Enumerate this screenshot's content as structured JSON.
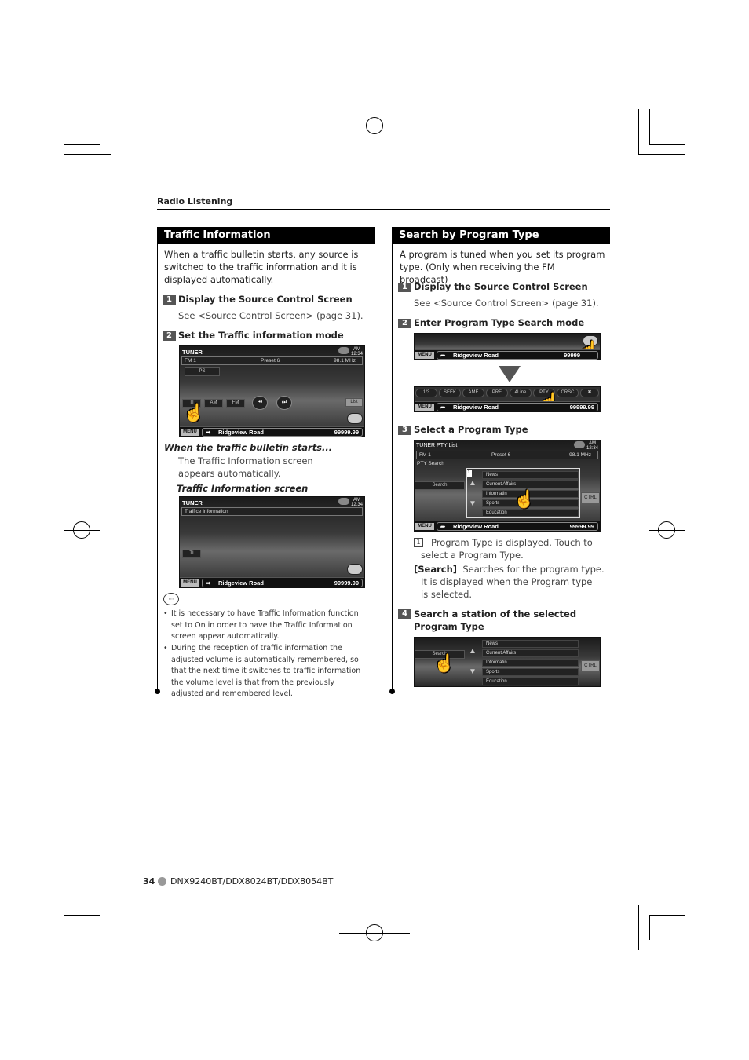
{
  "section_label": "Radio Listening",
  "left": {
    "header": "Traffic Information",
    "intro": "When a traffic bulletin starts, any source is switched to the traffic information and it is displayed automatically.",
    "steps": [
      {
        "num": "1",
        "title": "Display the Source Control Screen",
        "desc": "See <Source Control Screen> (page 31)."
      },
      {
        "num": "2",
        "title": "Set the Traffic information mode"
      }
    ],
    "screen1": {
      "title": "TUNER",
      "clock_ampm": "AM",
      "clock_time": "12:34",
      "band": "FM 1",
      "preset": "Preset 6",
      "freq": "98.1 MHz",
      "ps": "PS",
      "buttons": [
        "TI",
        "AM",
        "FM"
      ],
      "list": "List",
      "menu": "MENU",
      "road": "Ridgeview Road",
      "distance": "99999.99"
    },
    "bulletin_heading": "When the traffic bulletin starts...",
    "bulletin_text": "The Traffic Information screen appears automatically.",
    "screen_heading": "Traffic Information screen",
    "screen2": {
      "title": "TUNER",
      "clock_ampm": "AM",
      "clock_time": "12:34",
      "info": "Traffice Information",
      "ti": "TI",
      "menu": "MENU",
      "road": "Ridgeview Road",
      "distance": "99999.99"
    },
    "notes": [
      "It is necessary to have Traffic Information function set to On in order to have the Traffic Information screen appear automatically.",
      "During the reception of traffic information the adjusted volume is automatically remembered, so that the next time it switches to traffic information the volume level is that from the previously adjusted and remembered level."
    ]
  },
  "right": {
    "header": "Search by Program Type",
    "intro": "A program is tuned when you set its program type. (Only when receiving the FM broadcast)",
    "steps": [
      {
        "num": "1",
        "title": "Display the Source Control Screen",
        "desc": "See <Source Control Screen> (page 31)."
      },
      {
        "num": "2",
        "title": "Enter Program Type Search mode"
      },
      {
        "num": "3",
        "title": "Select a Program Type"
      },
      {
        "num": "4",
        "title": "Search a station of the selected Program Type"
      }
    ],
    "screen3": {
      "menu": "MENU",
      "road": "Ridgeview Road",
      "distance": "99999"
    },
    "screen4": {
      "buttons": [
        "1/3",
        "SEEK",
        "AME",
        "PRE",
        "4Line",
        "PTY",
        "CRSC"
      ],
      "menu": "MENU",
      "road": "Ridgeview Road",
      "distance": "99999.99"
    },
    "screen5": {
      "title": "TUNER PTY List",
      "clock_ampm": "AM",
      "clock_time": "12:34",
      "band": "FM 1",
      "preset": "Preset 6",
      "freq": "98.1 MHz",
      "pty_search": "PTY Search",
      "search": "Search",
      "callout": "1",
      "items": [
        "News",
        "Current Affairs",
        "Informatin",
        "Sports",
        "Education"
      ],
      "ctrl": "CTRL",
      "menu": "MENU",
      "road": "Ridgeview Road",
      "distance": "99999.99"
    },
    "item1_num": "1",
    "item1_text": "Program Type is displayed. Touch to select a Program Type.",
    "search_label": "[Search]",
    "search_text": "Searches for the program type.",
    "search_text2": "It is displayed when the Program type is selected.",
    "screen6": {
      "search": "Search",
      "items": [
        "News",
        "Current Affairs",
        "Informatin",
        "Sports",
        "Education"
      ],
      "ctrl": "CTRL"
    }
  },
  "footer": {
    "page": "34",
    "models": "DNX9240BT/DDX8024BT/DDX8054BT"
  }
}
